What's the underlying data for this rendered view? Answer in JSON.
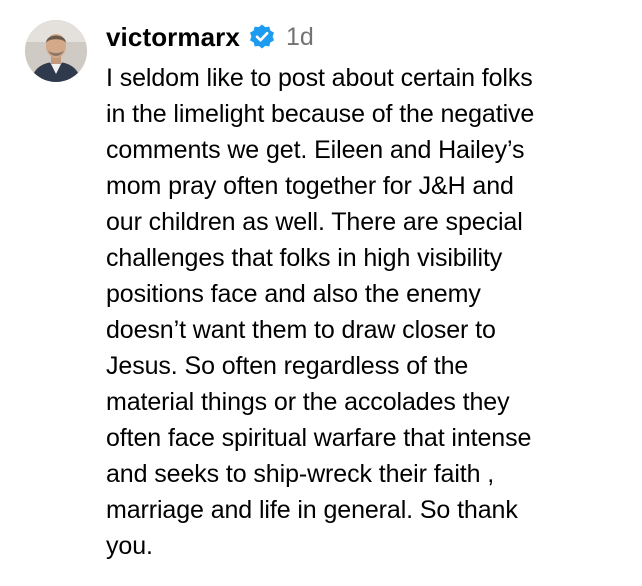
{
  "comment": {
    "username": "victormarx",
    "verified_icon": "verified-badge-icon",
    "verified_color": "#1d9bf0",
    "timestamp": "1d",
    "text_lines": [
      "I seldom like to post about certain folks",
      "in the limelight because of the negative",
      "comments we get. Eileen and Hailey’s",
      "mom pray often together for J&H and",
      "our children as well. There are special",
      "challenges that folks in high visibility",
      "positions face and also the enemy",
      "doesn’t want them to draw closer to",
      "Jesus. So often regardless of the",
      "material things or the accolades they",
      "often face spiritual warfare that intense",
      "and seeks to ship-wreck their faith ,",
      "marriage and life in general. So thank",
      "you."
    ]
  }
}
